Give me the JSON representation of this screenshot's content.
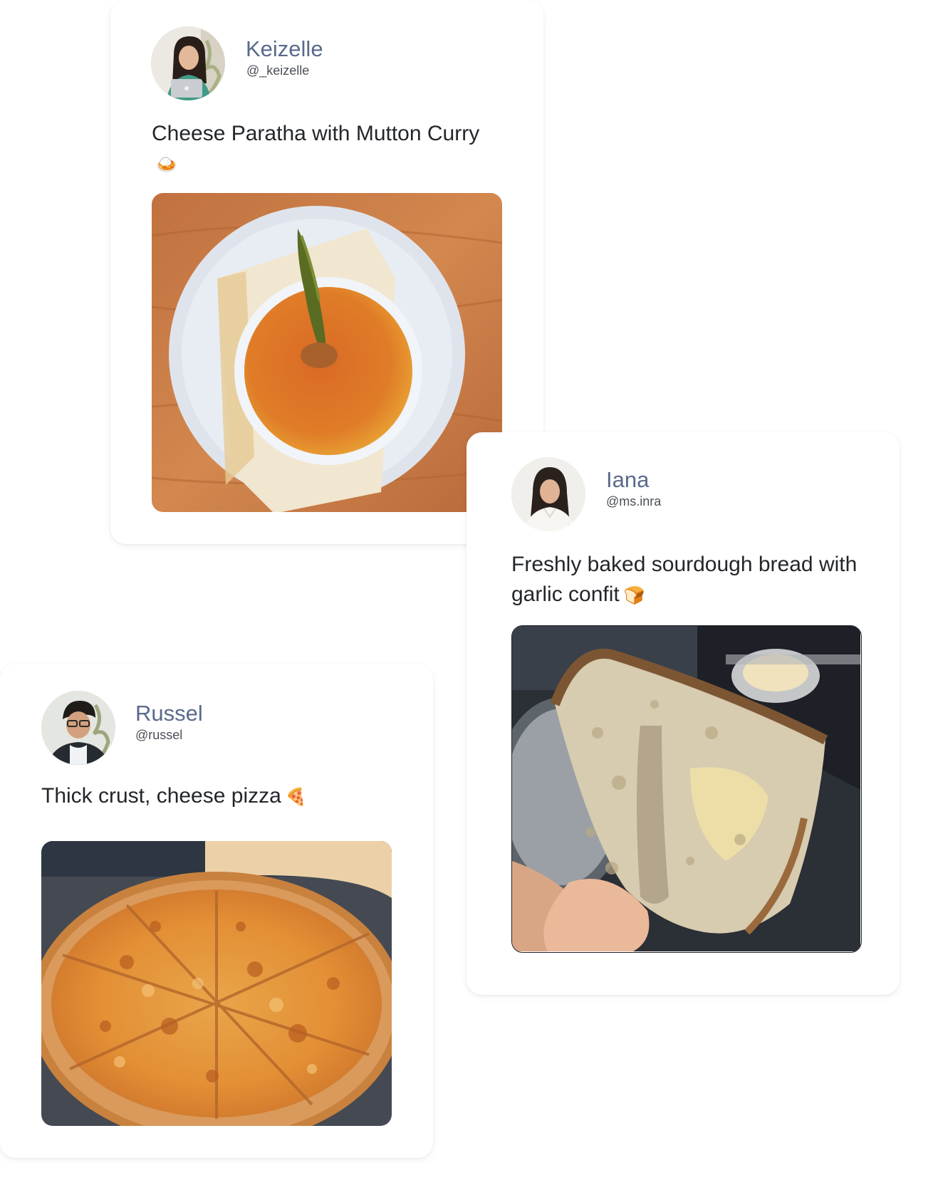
{
  "posts": [
    {
      "name": "Keizelle",
      "handle": "@_keizelle",
      "text": "Cheese Paratha with Mutton Curry",
      "emoji": "🍛",
      "avatar_icon": "user-avatar-photo",
      "photo_icon": "food-photo-curry"
    },
    {
      "name": "Iana",
      "handle": "@ms.inra",
      "text": "Freshly baked sourdough bread with garlic confit",
      "emoji": "🍞",
      "avatar_icon": "user-avatar-photo",
      "photo_icon": "food-photo-bread"
    },
    {
      "name": "Russel",
      "handle": "@russel",
      "text": "Thick crust, cheese pizza",
      "emoji": "🍕",
      "avatar_icon": "user-avatar-photo",
      "photo_icon": "food-photo-pizza"
    }
  ],
  "colors": {
    "name_text": "#5a6a8c",
    "body_text": "#23262b",
    "card_bg": "#ffffff"
  }
}
